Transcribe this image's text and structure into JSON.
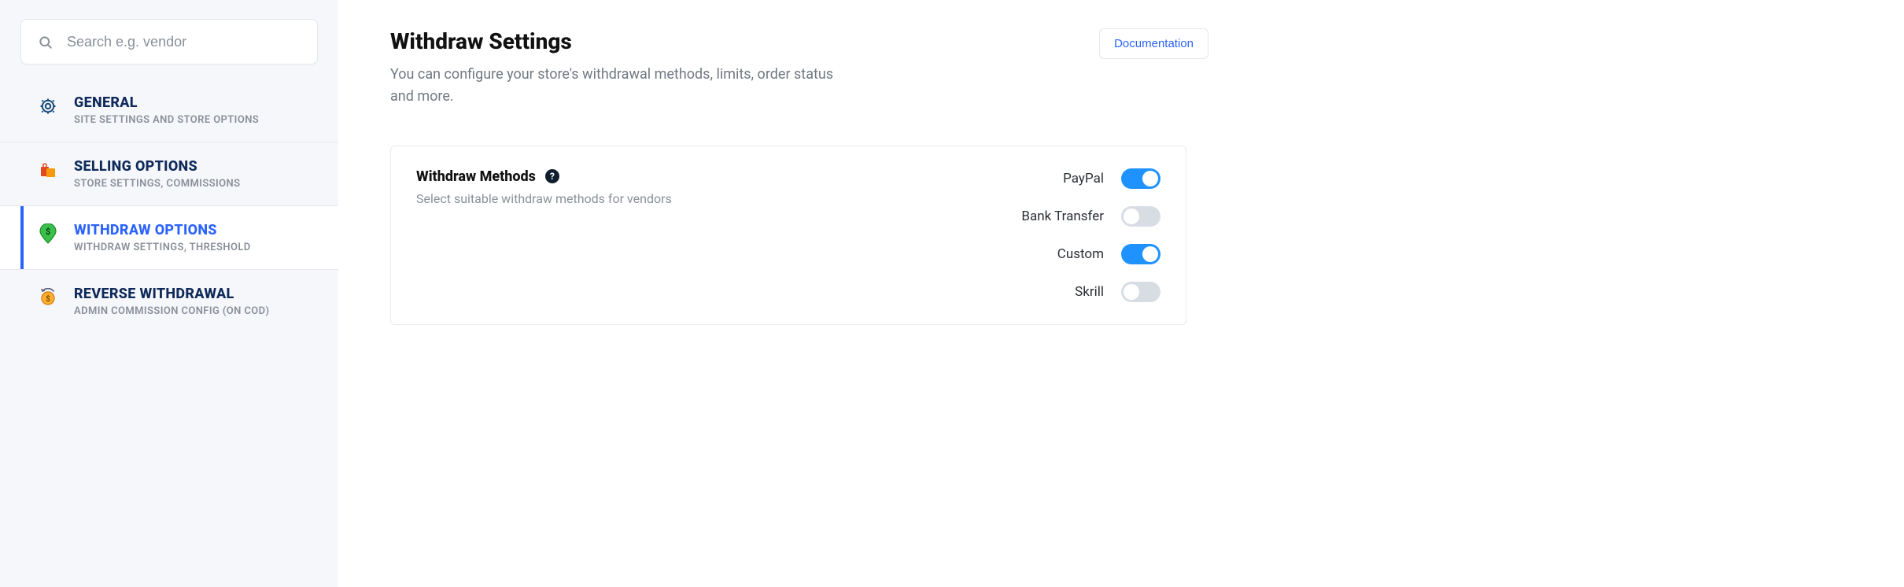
{
  "search": {
    "placeholder": "Search e.g. vendor"
  },
  "sidebar": {
    "items": [
      {
        "label": "GENERAL",
        "sub": "SITE SETTINGS AND STORE OPTIONS"
      },
      {
        "label": "SELLING OPTIONS",
        "sub": "STORE SETTINGS, COMMISSIONS"
      },
      {
        "label": "WITHDRAW OPTIONS",
        "sub": "WITHDRAW SETTINGS, THRESHOLD"
      },
      {
        "label": "REVERSE WITHDRAWAL",
        "sub": "ADMIN COMMISSION CONFIG (ON COD)"
      }
    ]
  },
  "header": {
    "title": "Withdraw Settings",
    "description": "You can configure your store's withdrawal methods, limits, order status and more.",
    "doc_button": "Documentation"
  },
  "section": {
    "title": "Withdraw Methods",
    "subtitle": "Select suitable withdraw methods for vendors",
    "help_glyph": "?",
    "methods": [
      {
        "name": "PayPal",
        "enabled": true
      },
      {
        "name": "Bank Transfer",
        "enabled": false
      },
      {
        "name": "Custom",
        "enabled": true
      },
      {
        "name": "Skrill",
        "enabled": false
      }
    ]
  }
}
